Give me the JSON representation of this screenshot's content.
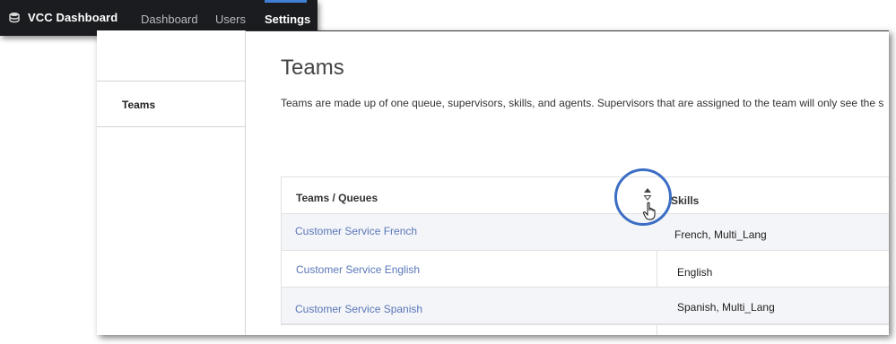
{
  "topbar": {
    "brand": "VCC Dashboard",
    "brand_icon": "database-icon",
    "nav": [
      {
        "label": "Dashboard",
        "active": false
      },
      {
        "label": "Users",
        "active": false
      },
      {
        "label": "Settings",
        "active": true
      }
    ],
    "accent_color": "#3f7fd6"
  },
  "sidebar": {
    "items": [
      {
        "label": "Teams"
      }
    ]
  },
  "main": {
    "title": "Teams",
    "description": "Teams are made up of one queue, supervisors, skills, and agents. Supervisors that are assigned to the team will only see the s",
    "table": {
      "columns": [
        "Teams / Queues",
        "Skills"
      ],
      "rows": [
        {
          "team": "Customer Service French",
          "skills": "French, Multi_Lang"
        },
        {
          "team": "Customer Service English",
          "skills": "English"
        },
        {
          "team": "Customer Service Spanish",
          "skills": "Spanish, Multi_Lang"
        }
      ]
    }
  },
  "annotation": {
    "highlight_color": "#3b6ec4",
    "icon": "sort-icon"
  }
}
